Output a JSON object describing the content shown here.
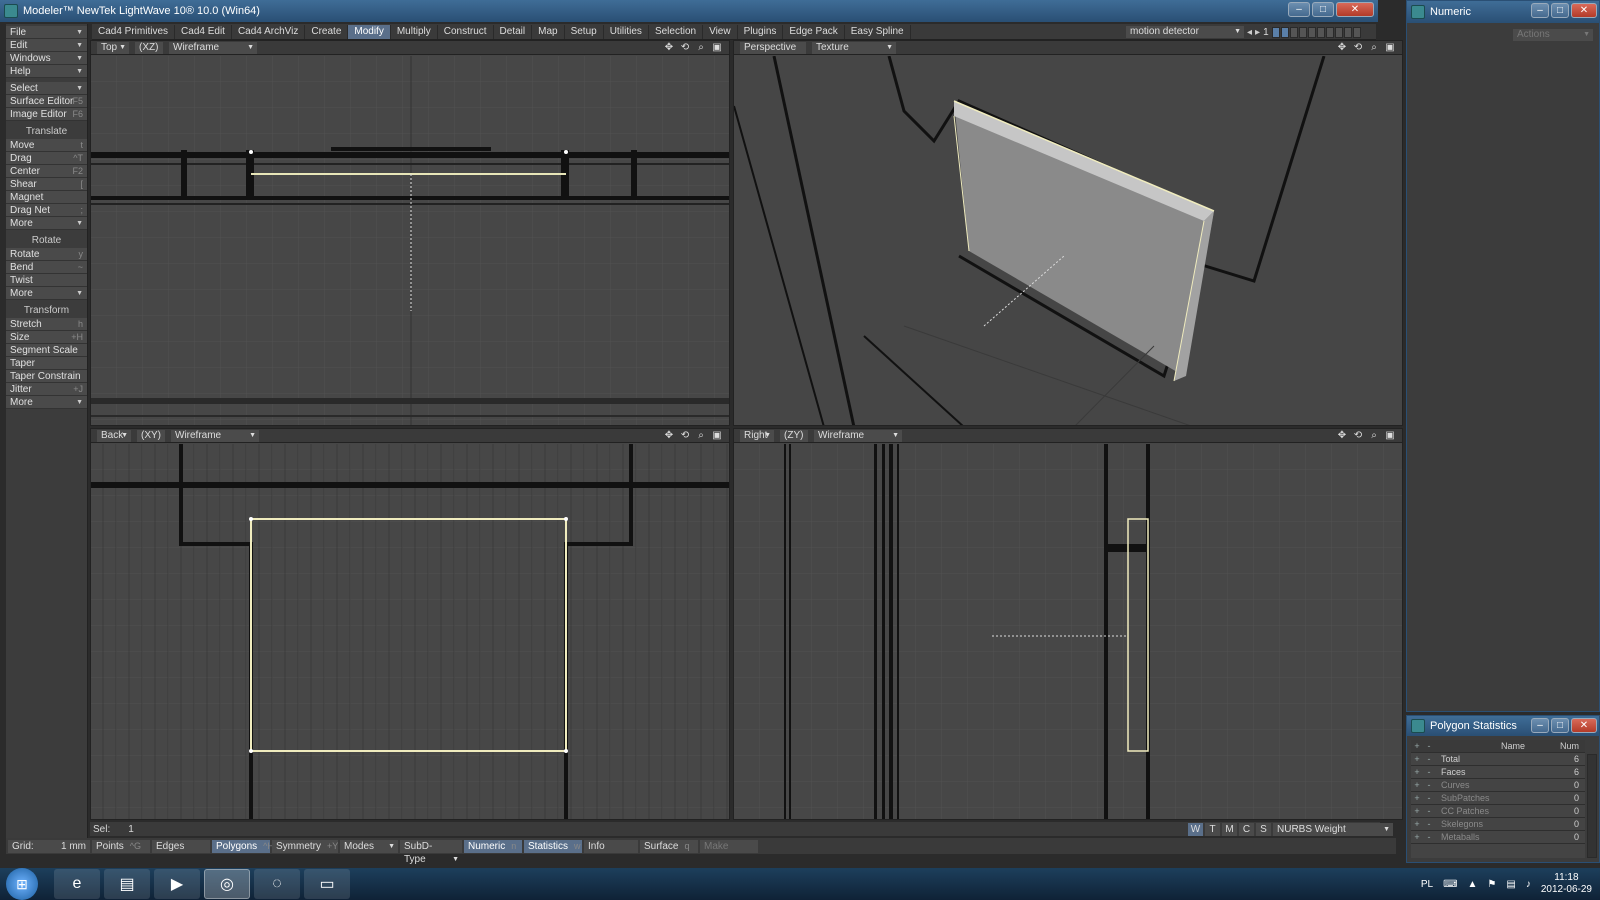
{
  "app": {
    "title": "Modeler™ NewTek LightWave 10® 10.0 (Win64)",
    "minimize": "–",
    "maximize": "□",
    "close": "✕"
  },
  "menu_tabs": [
    {
      "label": "Cad4 Primitives",
      "active": false
    },
    {
      "label": "Cad4 Edit",
      "active": false
    },
    {
      "label": "Cad4 ArchViz",
      "active": false
    },
    {
      "label": "Create",
      "active": false
    },
    {
      "label": "Modify",
      "active": true
    },
    {
      "label": "Multiply",
      "active": false
    },
    {
      "label": "Construct",
      "active": false
    },
    {
      "label": "Detail",
      "active": false
    },
    {
      "label": "Map",
      "active": false
    },
    {
      "label": "Setup",
      "active": false
    },
    {
      "label": "Utilities",
      "active": false
    },
    {
      "label": "Selection",
      "active": false
    },
    {
      "label": "View",
      "active": false
    },
    {
      "label": "Plugins",
      "active": false
    },
    {
      "label": "Edge Pack",
      "active": false
    },
    {
      "label": "Easy Spline",
      "active": false
    }
  ],
  "layer_select": "motion detector",
  "layer_number": "1",
  "left_menus": [
    {
      "label": "File"
    },
    {
      "label": "Edit"
    },
    {
      "label": "Windows"
    },
    {
      "label": "Help"
    }
  ],
  "left_tools_top": [
    {
      "label": "Select",
      "shortcut": "",
      "dropdown": true
    },
    {
      "label": "Surface Editor",
      "shortcut": "F5"
    },
    {
      "label": "Image Editor",
      "shortcut": "F6"
    }
  ],
  "translate": {
    "header": "Translate",
    "items": [
      {
        "label": "Move",
        "shortcut": "t"
      },
      {
        "label": "Drag",
        "shortcut": "^T"
      },
      {
        "label": "Center",
        "shortcut": "F2"
      },
      {
        "label": "Shear",
        "shortcut": "["
      },
      {
        "label": "Magnet",
        "shortcut": ""
      },
      {
        "label": "Drag Net",
        "shortcut": ";"
      },
      {
        "label": "More",
        "shortcut": "",
        "dropdown": true
      }
    ]
  },
  "rotate": {
    "header": "Rotate",
    "items": [
      {
        "label": "Rotate",
        "shortcut": "y"
      },
      {
        "label": "Bend",
        "shortcut": "~"
      },
      {
        "label": "Twist",
        "shortcut": ""
      },
      {
        "label": "More",
        "shortcut": "",
        "dropdown": true
      }
    ]
  },
  "transform": {
    "header": "Transform",
    "items": [
      {
        "label": "Stretch",
        "shortcut": "h"
      },
      {
        "label": "Size",
        "shortcut": "+H"
      },
      {
        "label": "Segment Scale",
        "shortcut": ""
      },
      {
        "label": "Taper",
        "shortcut": ""
      },
      {
        "label": "Taper Constrain",
        "shortcut": ""
      },
      {
        "label": "Jitter",
        "shortcut": "+J"
      },
      {
        "label": "More",
        "shortcut": "",
        "dropdown": true
      }
    ]
  },
  "viewports": {
    "top_left": {
      "view": "Top",
      "axis": "(XZ)",
      "mode": "Wireframe"
    },
    "top_right": {
      "view": "Perspective",
      "mode": "Texture"
    },
    "bottom_left": {
      "view": "Back",
      "axis": "(XY)",
      "mode": "Wireframe"
    },
    "bottom_right": {
      "view": "Right",
      "axis": "(ZY)",
      "mode": "Wireframe"
    }
  },
  "viewport_icons": [
    "move-view-icon",
    "rotate-view-icon",
    "zoom-view-icon",
    "maximize-view-icon"
  ],
  "status": {
    "sel_label": "Sel:",
    "sel_value": "1",
    "grid_label": "Grid:",
    "grid_value": "1 mm"
  },
  "bottom_buttons": [
    {
      "label": "Points",
      "shortcut": "^G",
      "active": false
    },
    {
      "label": "Edges",
      "shortcut": "",
      "active": false
    },
    {
      "label": "Polygons",
      "shortcut": "^H",
      "active": true
    },
    {
      "label": "Symmetry",
      "shortcut": "+Y",
      "active": false
    },
    {
      "label": "Modes",
      "shortcut": "",
      "active": false,
      "dropdown": true
    },
    {
      "label": "SubD-Type",
      "shortcut": "",
      "active": false,
      "dropdown": true
    },
    {
      "label": "Numeric",
      "shortcut": "n",
      "active": true
    },
    {
      "label": "Statistics",
      "shortcut": "w",
      "active": true
    },
    {
      "label": "Info",
      "shortcut": "",
      "active": false
    },
    {
      "label": "Surface",
      "shortcut": "q",
      "active": false
    },
    {
      "label": "Make",
      "shortcut": "",
      "active": false
    }
  ],
  "wtmcs": [
    "W",
    "T",
    "M",
    "C",
    "S"
  ],
  "vmap_select": "NURBS Weight",
  "numeric_panel": {
    "title": "Numeric",
    "actions": "Actions"
  },
  "polygon_stats": {
    "title": "Polygon Statistics",
    "col_name": "Name",
    "col_num": "Num",
    "rows": [
      {
        "name": "Total",
        "num": "6"
      },
      {
        "name": "Faces",
        "num": "6"
      },
      {
        "name": "Curves",
        "num": "0"
      },
      {
        "name": "SubPatches",
        "num": "0"
      },
      {
        "name": "CC Patches",
        "num": "0"
      },
      {
        "name": "Skelegons",
        "num": "0"
      },
      {
        "name": "Metaballs",
        "num": "0"
      }
    ]
  },
  "taskbar": {
    "lang": "PL",
    "time": "11:18",
    "date": "2012-06-29",
    "apps": [
      "ie-icon",
      "explorer-icon",
      "media-player-icon",
      "lightwave-icon",
      "browser-icon",
      "window-icon"
    ]
  }
}
